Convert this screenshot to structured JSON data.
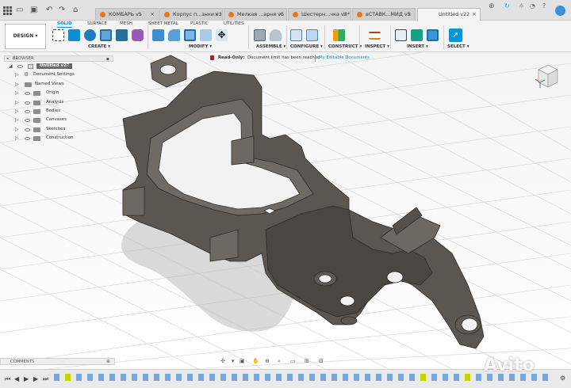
{
  "tabs": [
    {
      "label": "КОМБАРЬ v5"
    },
    {
      "label": "Корпус п...знки v3*"
    },
    {
      "label": "Мелкая ...арня v5"
    },
    {
      "label": "Шестерн...чка v3*"
    },
    {
      "label": "вСТАВК...МИД v5"
    },
    {
      "label": "Untitled v22"
    }
  ],
  "ribbon": {
    "workspace_label": "DESIGN",
    "workspace_tabs": [
      "SOLID",
      "SURFACE",
      "MESH",
      "SHEET METAL",
      "PLASTIC",
      "UTILITIES"
    ],
    "groups": {
      "create": "CREATE",
      "modify": "MODIFY",
      "assemble": "ASSEMBLE",
      "configure": "CONFIGURE",
      "construct": "CONSTRUCT",
      "inspect": "INSPECT",
      "insert": "INSERT",
      "select": "SELECT"
    }
  },
  "browser": {
    "title": "BROWSER",
    "root": "Untitled v22",
    "items": [
      {
        "label": "Document Settings",
        "icon": "gear-icon"
      },
      {
        "label": "Named Views",
        "icon": "folder-icon"
      },
      {
        "label": "Origin",
        "icon": "folder-icon"
      },
      {
        "label": "Analysis",
        "icon": "folder-icon"
      },
      {
        "label": "Bodies",
        "icon": "folder-icon"
      },
      {
        "label": "Canvases",
        "icon": "folder-icon"
      },
      {
        "label": "Sketches",
        "icon": "folder-icon"
      },
      {
        "label": "Construction",
        "icon": "folder-icon"
      }
    ]
  },
  "notice": {
    "status": "Read-Only:",
    "message": "Document limit has been reached",
    "link": "My Editable Documents"
  },
  "comments": {
    "title": "COMMENTS"
  },
  "watermark": "Avito",
  "colors": {
    "accent": "#0696d7",
    "model": "#5b5650",
    "active_tab_icon": "#e8761b",
    "readonly": "#c8102e"
  }
}
